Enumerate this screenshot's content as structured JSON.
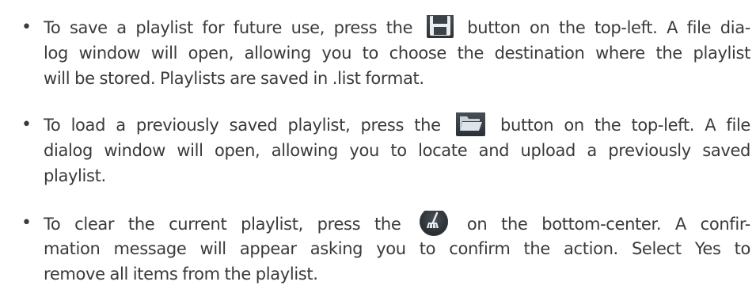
{
  "bullets": [
    {
      "marker": "•",
      "lines": [
        {
          "before": "To save a playlist for future use, press the",
          "icon": "save-icon",
          "after": "button on the top-left. A file dia-"
        },
        {
          "text": "log window will open, allowing you to choose the destination where the playlist"
        },
        {
          "text": "will be stored. Playlists are saved in .list format."
        }
      ]
    },
    {
      "marker": "•",
      "lines": [
        {
          "before": "To load a previously saved playlist, press the",
          "icon": "folder-open-icon",
          "after": "button on the top-left. A file"
        },
        {
          "text": "dialog window will open, allowing you to locate and upload a previously saved"
        },
        {
          "text": "playlist."
        }
      ]
    },
    {
      "marker": "•",
      "lines": [
        {
          "before": "To clear the current playlist, press the",
          "icon": "broom-clear-icon",
          "after": "on the bottom-center. A confir-"
        },
        {
          "text": "mation message will appear asking you to confirm the action. Select Yes to"
        },
        {
          "text": "remove all items from the playlist."
        }
      ]
    }
  ],
  "colors": {
    "text": "#3a3a3a",
    "icon_bg": "#2c3238",
    "icon_fg": "#e9eef2",
    "folder_fg": "#c9d1d8"
  }
}
